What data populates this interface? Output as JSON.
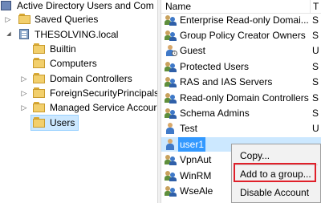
{
  "tree": {
    "root_label": "Active Directory Users and Com",
    "items": [
      {
        "label": "Saved Queries",
        "expand": "▷"
      },
      {
        "label": "THESOLVING.local",
        "expand": "◢"
      },
      {
        "label": "Builtin",
        "expand": ""
      },
      {
        "label": "Computers",
        "expand": ""
      },
      {
        "label": "Domain Controllers",
        "expand": "▷"
      },
      {
        "label": "ForeignSecurityPrincipals",
        "expand": "▷"
      },
      {
        "label": "Managed Service Accour",
        "expand": "▷"
      },
      {
        "label": "Users",
        "expand": ""
      }
    ]
  },
  "list": {
    "columns": [
      "Name",
      "T"
    ],
    "rows": [
      {
        "name": "Enterprise Read-only Domai...",
        "type": "S",
        "icon": "group-icon"
      },
      {
        "name": "Group Policy Creator Owners",
        "type": "S",
        "icon": "group-icon"
      },
      {
        "name": "Guest",
        "type": "U",
        "icon": "user-disabled-icon"
      },
      {
        "name": "Protected Users",
        "type": "S",
        "icon": "group-icon"
      },
      {
        "name": "RAS and IAS Servers",
        "type": "S",
        "icon": "group-icon"
      },
      {
        "name": "Read-only Domain Controllers",
        "type": "S",
        "icon": "group-icon"
      },
      {
        "name": "Schema Admins",
        "type": "S",
        "icon": "group-icon"
      },
      {
        "name": "Test",
        "type": "U",
        "icon": "user-icon"
      },
      {
        "name": "user1",
        "type": "",
        "icon": "user-icon"
      },
      {
        "name": "VpnAut",
        "type": "",
        "icon": "group-icon"
      },
      {
        "name": "WinRM",
        "type": "",
        "icon": "group-icon"
      },
      {
        "name": "WseAle",
        "type": "",
        "icon": "group-icon"
      }
    ]
  },
  "context_menu": {
    "items": [
      "Copy...",
      "Add to a group...",
      "Disable Account"
    ]
  },
  "colors": {
    "selection": "#3399ff",
    "highlight_box": "#e0202a"
  }
}
